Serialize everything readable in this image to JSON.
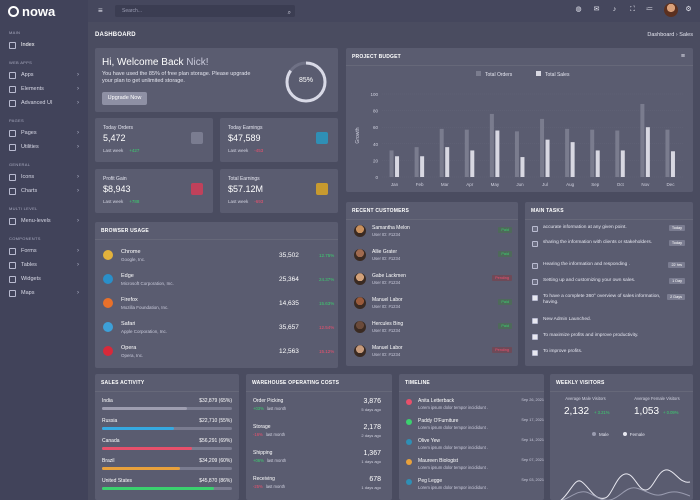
{
  "app": {
    "name": "nowa"
  },
  "sidebar": {
    "sections": [
      {
        "title": "Main",
        "items": [
          {
            "label": "Index",
            "chev": ""
          }
        ]
      },
      {
        "title": "Web Apps",
        "items": [
          {
            "label": "Apps",
            "chev": "›"
          },
          {
            "label": "Elements",
            "chev": "›"
          },
          {
            "label": "Advanced UI",
            "chev": "›"
          }
        ]
      },
      {
        "title": "Pages",
        "items": [
          {
            "label": "Pages",
            "chev": "›"
          },
          {
            "label": "Utilities",
            "chev": "›"
          }
        ]
      },
      {
        "title": "General",
        "items": [
          {
            "label": "Icons",
            "chev": "›"
          },
          {
            "label": "Charts",
            "chev": "›"
          }
        ]
      },
      {
        "title": "Multi Level",
        "items": [
          {
            "label": "Menu-levels",
            "chev": "›"
          }
        ]
      },
      {
        "title": "Components",
        "items": [
          {
            "label": "Forms",
            "chev": "›"
          },
          {
            "label": "Tables",
            "chev": "›"
          },
          {
            "label": "Widgets",
            "chev": ""
          },
          {
            "label": "Maps",
            "chev": "›"
          }
        ]
      }
    ]
  },
  "topbar": {
    "search_placeholder": "Search..."
  },
  "header": {
    "title": "DASHBOARD",
    "breadcrumb": "Dashboard",
    "breadcrumb_current": "Sales",
    "sep": "›"
  },
  "welcome": {
    "greeting": "Hi, Welcome Back ",
    "name": "Nick!",
    "text": "You have used the 85% of free plan storage. Please upgrade your plan to get unlimited storage.",
    "button": "Upgrade Now",
    "percent_label": "85%",
    "percent": 85
  },
  "stats": [
    {
      "label": "Today Orders",
      "value": "5,472",
      "sub": "Last week",
      "change": "+427",
      "dir": "up",
      "color": "#7a7c90"
    },
    {
      "label": "Today Earnings",
      "value": "$47,589",
      "sub": "Last week",
      "change": "-453",
      "dir": "dn",
      "color": "#2f8fb5"
    },
    {
      "label": "Profit Gain",
      "value": "$8,943",
      "sub": "Last week",
      "change": "+788",
      "dir": "up",
      "color": "#c0415b"
    },
    {
      "label": "Total Earnings",
      "value": "$57.12M",
      "sub": "Last week",
      "change": "-693",
      "dir": "dn",
      "color": "#c79a2f"
    }
  ],
  "browser": {
    "title": "Browser Usage",
    "rows": [
      {
        "name": "Chrome",
        "company": "Google, Inc.",
        "value": "35,502",
        "pct": "12.75%",
        "dir": "up",
        "color": "#e3b23c"
      },
      {
        "name": "Edge",
        "company": "Microsoft Corporation, Inc.",
        "value": "25,364",
        "pct": "24.37%",
        "dir": "up",
        "color": "#2a8fc9"
      },
      {
        "name": "Firefox",
        "company": "Mozilla Foundation, Inc.",
        "value": "14,635",
        "pct": "15.63%",
        "dir": "up",
        "color": "#e8702a"
      },
      {
        "name": "Safari",
        "company": "Apple Corporation, Inc.",
        "value": "35,657",
        "pct": "12.54%",
        "dir": "dn",
        "color": "#3da0d8"
      },
      {
        "name": "Opera",
        "company": "Opera, Inc.",
        "value": "12,563",
        "pct": "15.12%",
        "dir": "dn",
        "color": "#d8293a"
      }
    ]
  },
  "budget": {
    "title": "Project Budget",
    "legend": [
      "Total Orders",
      "Total Sales"
    ]
  },
  "chart_data": {
    "type": "bar",
    "title": "Project Budget",
    "ylabel": "Growth",
    "ylim": [
      0,
      100
    ],
    "yticks": [
      0,
      20,
      40,
      60,
      80,
      100
    ],
    "categories": [
      "Jan",
      "Feb",
      "Mar",
      "Apr",
      "May",
      "Jun",
      "Jul",
      "Aug",
      "Sep",
      "Oct",
      "Nov",
      "Dec"
    ],
    "series": [
      {
        "name": "Total Orders",
        "values": [
          32,
          36,
          58,
          57,
          76,
          55,
          70,
          58,
          57,
          56,
          88,
          57
        ]
      },
      {
        "name": "Total Sales",
        "values": [
          25,
          25,
          36,
          32,
          56,
          24,
          45,
          42,
          32,
          32,
          60,
          31
        ]
      }
    ],
    "legend_position": "top",
    "colors": [
      "#7a7c8e",
      "#d8d8e2"
    ]
  },
  "customers": {
    "title": "Recent Customers",
    "rows": [
      {
        "name": "Samantha Melon",
        "id": "User ID: #1234",
        "status": "Paid",
        "color": "#c9905d"
      },
      {
        "name": "Allie Grater",
        "id": "User ID: #1234",
        "status": "Paid",
        "color": "#a06a4f"
      },
      {
        "name": "Gabe Lackmen",
        "id": "User ID: #1234",
        "status": "Pending",
        "color": "#d2a17a"
      },
      {
        "name": "Manuel Labor",
        "id": "User ID: #1234",
        "status": "Paid",
        "color": "#9a5b3c"
      },
      {
        "name": "Hercules Bing",
        "id": "User ID: #1234",
        "status": "Paid",
        "color": "#6a4a3a"
      },
      {
        "name": "Manuel Labor",
        "id": "User ID: #1234",
        "status": "Pending",
        "color": "#c69a7b"
      }
    ]
  },
  "tasks": {
    "title": "Main Tasks",
    "rows": [
      {
        "text": "accurate information at any given point.",
        "tag": "Today",
        "done": false
      },
      {
        "text": "sharing the information with clients or stakeholders.",
        "tag": "Today",
        "done": false
      },
      {
        "text": "Hearing the information and responding .",
        "tag": "22 hrs",
        "done": false
      },
      {
        "text": "Setting up and customizing your own sales.",
        "tag": "1 Day",
        "done": false
      },
      {
        "text": "To have a complete 360° overview of sales information, having.",
        "tag": "2 Days",
        "done": true
      },
      {
        "text": "New Admin Launched.",
        "tag": "",
        "done": true
      },
      {
        "text": "To maximize profits and improve productivity.",
        "tag": "",
        "done": true
      },
      {
        "text": "To improve profits.",
        "tag": "",
        "done": true
      }
    ]
  },
  "sales": {
    "title": "Sales Activity",
    "rows": [
      {
        "name": "India",
        "amount": "$32,879 (65%)",
        "pct": 65,
        "color": "#9e9eb0"
      },
      {
        "name": "Russia",
        "amount": "$22,710 (55%)",
        "pct": 55,
        "color": "#36a9e1"
      },
      {
        "name": "Canada",
        "amount": "$56,291 (69%)",
        "pct": 69,
        "color": "#e8506b"
      },
      {
        "name": "Brazil",
        "amount": "$34,209 (60%)",
        "pct": 60,
        "color": "#e8a13c"
      },
      {
        "name": "United States",
        "amount": "$45,870 (86%)",
        "pct": 86,
        "color": "#3bd16f"
      }
    ]
  },
  "warehouse": {
    "title": "Warehouse Operating Costs",
    "rows": [
      {
        "name": "Order Picking",
        "value": "3,876",
        "change": "+03%",
        "change_label": "last month",
        "ago": "5 days ago",
        "dir": "up"
      },
      {
        "name": "Storage",
        "value": "2,178",
        "change": "-16%",
        "change_label": "last month",
        "ago": "2 days ago",
        "dir": "dn"
      },
      {
        "name": "Shipping",
        "value": "1,367",
        "change": "+06%",
        "change_label": "last month",
        "ago": "1 days ago",
        "dir": "up"
      },
      {
        "name": "Receiving",
        "value": "678",
        "change": "-25%",
        "change_label": "last month",
        "ago": "1 days ago",
        "dir": "dn"
      }
    ]
  },
  "timeline": {
    "title": "Timeline",
    "rows": [
      {
        "name": "Anita Letterback",
        "desc": "Lorem ipsum dolor tempor incididunt .",
        "date": "Sep 26, 2021",
        "color": "#e8506b"
      },
      {
        "name": "Paddy O'Furniture",
        "desc": "Lorem ipsum dolor tempor incididunt .",
        "date": "Sep 17, 2021",
        "color": "#3bd16f"
      },
      {
        "name": "Olive Yew",
        "desc": "Lorem ipsum dolor tempor incididunt .",
        "date": "Sep 14, 2021",
        "color": "#2f8fb5"
      },
      {
        "name": "Maureen Biologist",
        "desc": "Lorem ipsum dolor tempor incididunt .",
        "date": "Sep 07, 2021",
        "color": "#e8a13c"
      },
      {
        "name": "Peg Legge",
        "desc": "Lorem ipsum dolor tempor incididunt .",
        "date": "Sep 03, 2021",
        "color": "#2f8fb5"
      }
    ]
  },
  "visitors": {
    "title": "Weekly Visitors",
    "male_label": "Average Male Visitors",
    "male_value": "2,132",
    "male_change": "+ 3.21%",
    "female_label": "Average Female Visitors",
    "female_value": "1,053",
    "female_change": "+ 0.09%",
    "legend": [
      "Male",
      "Female"
    ]
  }
}
